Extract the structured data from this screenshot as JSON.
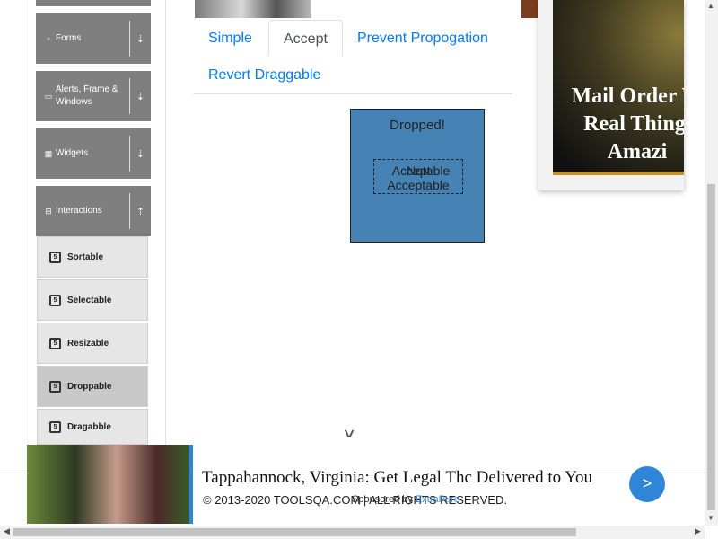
{
  "sidebar": {
    "groups": [
      {
        "label": "Forms",
        "icon": "document-icon",
        "toggle": "expand"
      },
      {
        "label": "Alerts, Frame & Windows",
        "icon": "window-icon",
        "toggle": "expand"
      },
      {
        "label": "Widgets",
        "icon": "grid-icon",
        "toggle": "expand"
      },
      {
        "label": "Interactions",
        "icon": "minus-square-icon",
        "toggle": "collapse"
      }
    ],
    "items": [
      {
        "label": "Sortable",
        "icon": "html5-icon",
        "active": false
      },
      {
        "label": "Selectable",
        "icon": "html5-icon",
        "active": false
      },
      {
        "label": "Resizable",
        "icon": "html5-icon",
        "active": false
      },
      {
        "label": "Droppable",
        "icon": "html5-icon",
        "active": true
      },
      {
        "label": "Dragabble",
        "icon": "html5-icon",
        "active": false
      }
    ]
  },
  "tabs": [
    "Simple",
    "Accept",
    "Prevent Propogation",
    "Revert Draggable"
  ],
  "active_tab": "Accept",
  "drop_zone": {
    "title": "Dropped!",
    "drag_text_under": "Accept",
    "drag_text_over": "Not",
    "drag_text_suffix_1": "able",
    "drag_text_line2": "Acceptable",
    "color": "#4682b4"
  },
  "ad_right": {
    "lines": [
      "Mail Order W",
      "Real Thing,",
      "Amazi"
    ]
  },
  "ad_bottom": {
    "title": "Tappahannock, Virginia: Get Legal Thc Delivered to You",
    "button": ">",
    "sponsor_prefix": "Sponsored by",
    "sponsor_brand": "ExtraPure"
  },
  "footer": {
    "copyright": "© 2013-2020 TOOLSQA.COM | ALL RIGHTS RESERVED."
  },
  "colors": {
    "accent": "#007bff",
    "sidebar_header": "#7f7f7f",
    "ad_button": "#2f86d8"
  }
}
